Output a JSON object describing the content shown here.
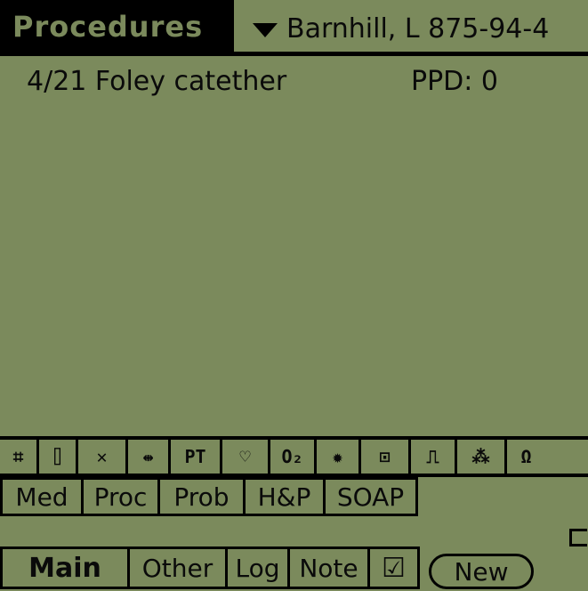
{
  "header": {
    "title": "Procedures",
    "patient": "Barnhill, L 875-94-4"
  },
  "records": [
    {
      "text": "4/21 Foley catether",
      "ppd": "PPD: 0"
    }
  ],
  "icons": [
    {
      "name": "grid-bug-icon",
      "glyph": "⌗"
    },
    {
      "name": "capsule-icon",
      "glyph": "⌷"
    },
    {
      "name": "cross-icon",
      "glyph": "✕"
    },
    {
      "name": "arrows-icon",
      "glyph": "⇹"
    },
    {
      "name": "pt-ptt-icon",
      "glyph": "PT"
    },
    {
      "name": "heart-icon",
      "glyph": "♡"
    },
    {
      "name": "oxygen-icon",
      "glyph": "O₂"
    },
    {
      "name": "bug-icon",
      "glyph": "✹"
    },
    {
      "name": "beaker-icon",
      "glyph": "⊡"
    },
    {
      "name": "pulse-icon",
      "glyph": "⎍"
    },
    {
      "name": "cells-icon",
      "glyph": "⁂"
    },
    {
      "name": "lungs-icon",
      "glyph": "Ω"
    }
  ],
  "tabs_row1": [
    "Med",
    "Proc",
    "Prob",
    "H&P",
    "SOAP"
  ],
  "tabs_row2": [
    "Main",
    "Other",
    "Log",
    "Note"
  ],
  "new_button": "New",
  "colors": {
    "lcd_background": "#7b8a5c",
    "ink": "#000000"
  }
}
